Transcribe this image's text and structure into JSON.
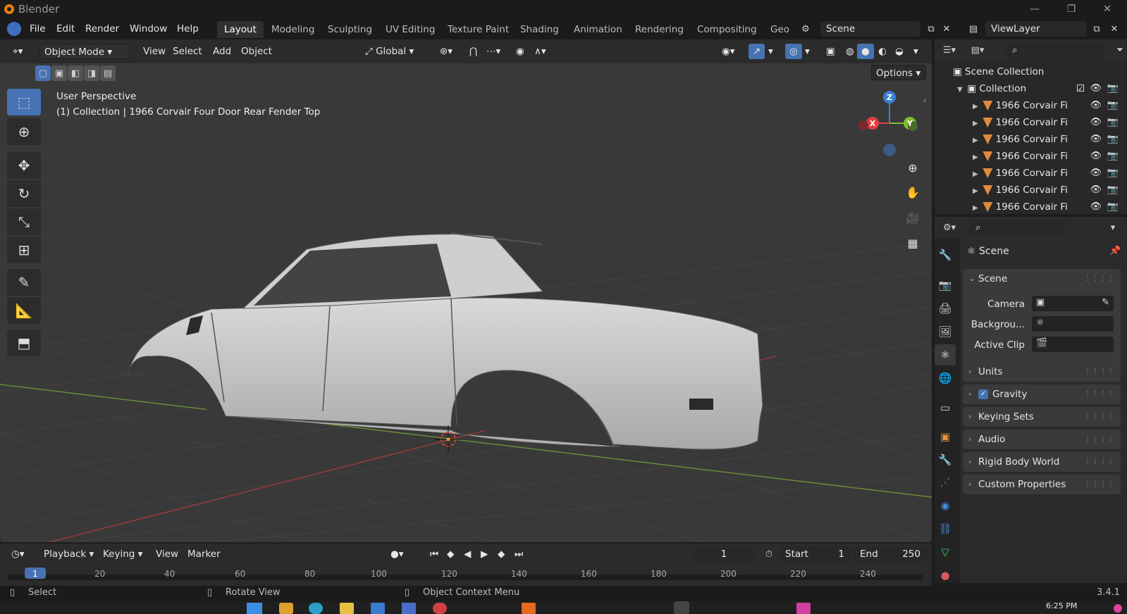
{
  "window": {
    "app_title": "Blender",
    "version": "3.4.1",
    "time": "6:25 PM"
  },
  "menu": {
    "file": "File",
    "edit": "Edit",
    "render": "Render",
    "window": "Window",
    "help": "Help"
  },
  "workspaces": [
    "Layout",
    "Modeling",
    "Sculpting",
    "UV Editing",
    "Texture Paint",
    "Shading",
    "Animation",
    "Rendering",
    "Compositing",
    "Geo"
  ],
  "scene_field": "Scene",
  "viewlayer_field": "ViewLayer",
  "viewport_header": {
    "mode": "Object Mode",
    "view": "View",
    "select": "Select",
    "add": "Add",
    "object": "Object",
    "transform": "Global",
    "options": "Options"
  },
  "viewport_overlay": {
    "perspective": "User Perspective",
    "context": "(1) Collection | 1966 Corvair Four Door Rear Fender Top"
  },
  "gizmo": {
    "z": "Z",
    "x": "X",
    "y": "Y"
  },
  "outliner": {
    "scene_collection": "Scene Collection",
    "collection": "Collection",
    "items": [
      "1966 Corvair Fi",
      "1966 Corvair Fi",
      "1966 Corvair Fi",
      "1966 Corvair Fi",
      "1966 Corvair Fi",
      "1966 Corvair Fi",
      "1966 Corvair Fi"
    ]
  },
  "properties": {
    "header": "Scene",
    "scene_panel": "Scene",
    "camera_label": "Camera",
    "background_label": "Backgrou...",
    "clip_label": "Active Clip",
    "panels": [
      "Units",
      "Gravity",
      "Keying Sets",
      "Audio",
      "Rigid Body World",
      "Custom Properties"
    ]
  },
  "timeline": {
    "playback": "Playback",
    "keying": "Keying",
    "view": "View",
    "marker": "Marker",
    "current_frame": "1",
    "start_label": "Start",
    "start": "1",
    "end_label": "End",
    "end": "250",
    "ticks": [
      "1",
      "20",
      "40",
      "60",
      "80",
      "100",
      "120",
      "140",
      "160",
      "180",
      "200",
      "220",
      "240"
    ]
  },
  "statusbar": {
    "select": "Select",
    "rotate": "Rotate View",
    "context_menu": "Object Context Menu"
  }
}
